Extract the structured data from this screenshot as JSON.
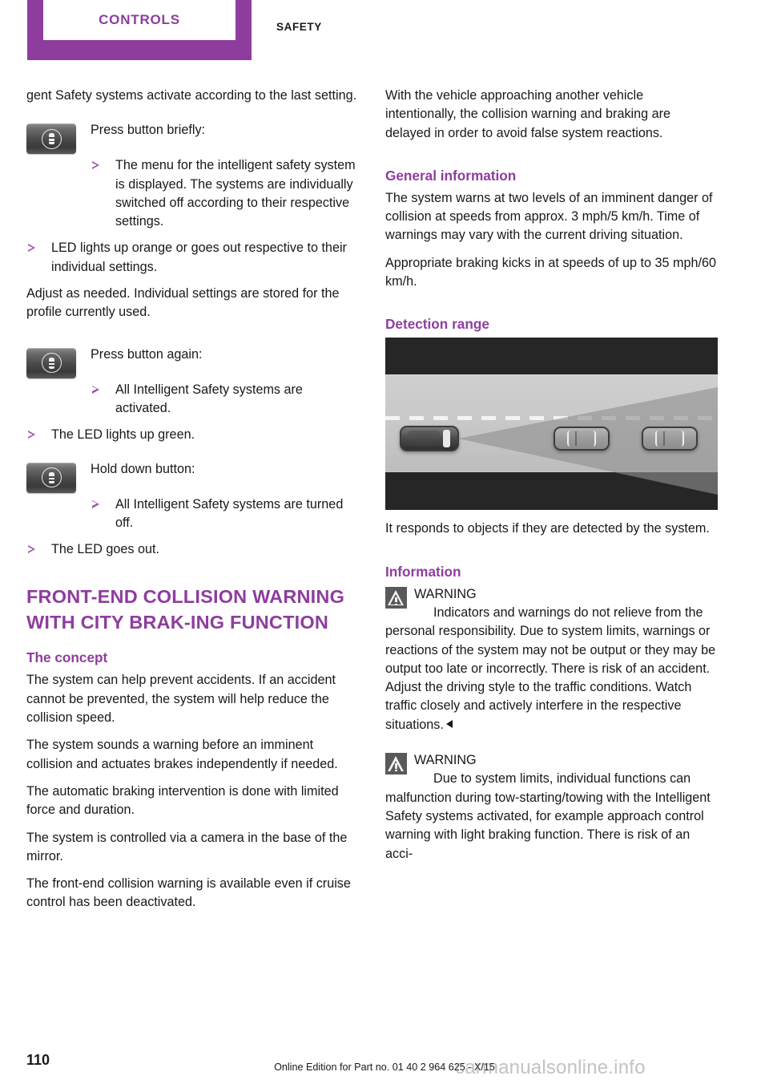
{
  "header": {
    "active_tab": "CONTROLS",
    "inactive_tab": "SAFETY",
    "accent_color": "#8e3d9e"
  },
  "left_column": {
    "intro_paragraph": "gent Safety systems activate according to the last setting.",
    "step1": {
      "icon": "intelligent-safety-button-icon",
      "lead": "Press button briefly:",
      "bullets": [
        "The menu for the intelligent safety system is displayed. The systems are individually switched off according to their respective settings."
      ]
    },
    "outer_bullets_1": [
      "LED lights up orange or goes out respective to their individual settings."
    ],
    "paragraph_adjust": "Adjust as needed. Individual settings are stored for the profile currently used.",
    "step2": {
      "icon": "intelligent-safety-button-icon",
      "lead": "Press button again:",
      "bullets": [
        "All Intelligent Safety systems are activated."
      ]
    },
    "outer_bullets_2": [
      "The LED lights up green."
    ],
    "step3": {
      "icon": "intelligent-safety-button-icon",
      "lead": "Hold down button:",
      "bullets": [
        "All Intelligent Safety systems are turned off."
      ]
    },
    "outer_bullets_3": [
      "The LED goes out."
    ],
    "section_title": "FRONT-END COLLISION WARNING WITH CITY BRAK-ING FUNCTION",
    "concept_heading": "The concept",
    "concept_paragraphs": [
      "The system can help prevent accidents. If an accident cannot be prevented, the system will help reduce the collision speed.",
      "The system sounds a warning before an imminent collision and actuates brakes independently if needed.",
      "The automatic braking intervention is done with limited force and duration.",
      "The system is controlled via a camera in the base of the mirror.",
      "The front-end collision warning is available even if cruise control has been deactivated."
    ]
  },
  "right_column": {
    "intro_paragraph": "With the vehicle approaching another vehicle intentionally, the collision warning and braking are delayed in order to avoid false system reactions.",
    "general_heading": "General information",
    "general_paragraphs": [
      "The system warns at two levels of an imminent danger of collision at speeds from approx. 3 mph/5 km/h. Time of warnings may vary with the current driving situation.",
      "Appropriate braking kicks in at speeds of up to 35 mph/60 km/h."
    ],
    "detection_heading": "Detection range",
    "figure": {
      "name": "detection-range-illustration",
      "alt": "Top-down view of a road with the ego vehicle emitting a detection cone toward two vehicles ahead"
    },
    "figure_caption": "It responds to objects if they are detected by the system.",
    "information_heading": "Information",
    "warnings": [
      {
        "label": "WARNING",
        "text": "Indicators and warnings do not relieve from the personal responsibility. Due to system limits, warnings or reactions of the system may not be output or they may be output too late or incorrectly. There is risk of an accident. Adjust the driving style to the traffic conditions. Watch traffic closely and actively interfere in the respective situations."
      },
      {
        "label": "WARNING",
        "text": "Due to system limits, individual functions can malfunction during tow-starting/towing with the Intelligent Safety systems activated, for example approach control warning with light braking function. There is risk of an acci-"
      }
    ]
  },
  "footer": {
    "page_number": "110",
    "edition": "Online Edition for Part no. 01 40 2 964 625 - X/15",
    "watermark": "carmanualsonline.info"
  }
}
